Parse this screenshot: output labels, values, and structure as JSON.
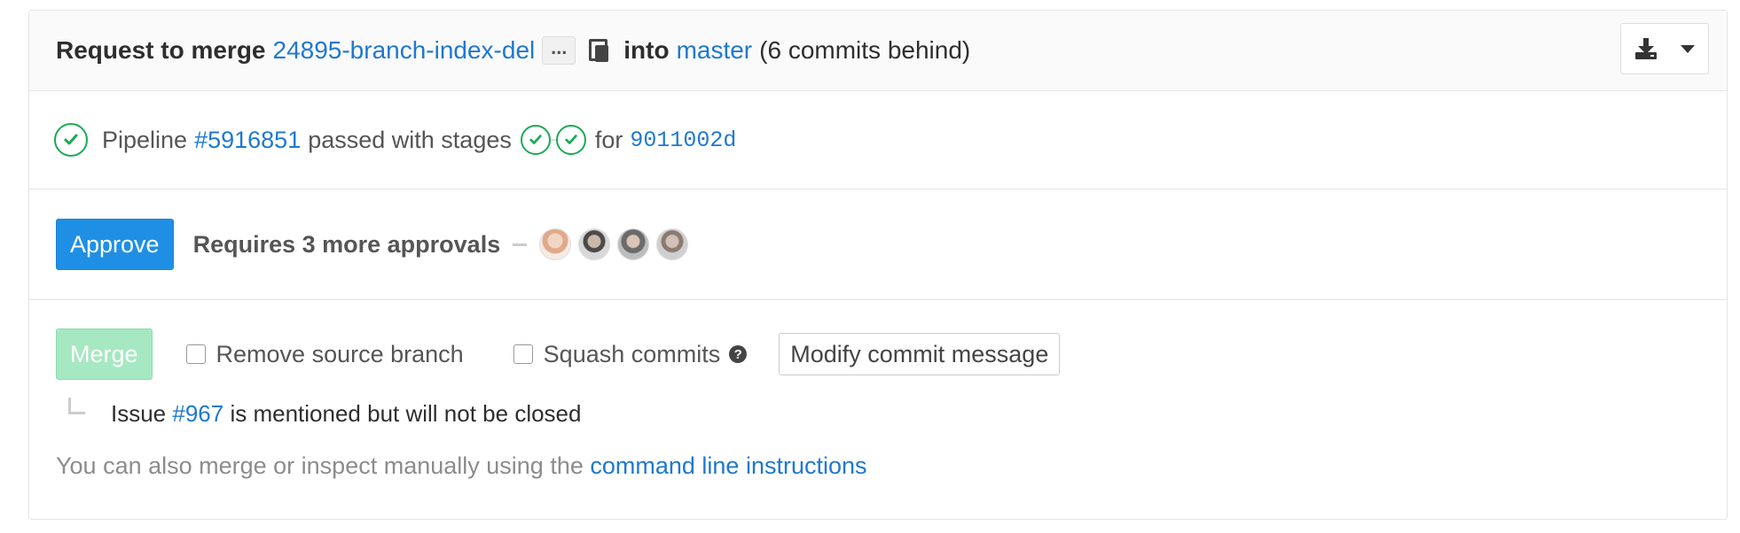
{
  "header": {
    "request_to_merge": "Request to merge",
    "source_branch": "24895-branch-index-del",
    "ellipsis": "...",
    "into": "into",
    "target_branch": "master",
    "commits_behind": "(6 commits behind)"
  },
  "pipeline": {
    "label": "Pipeline",
    "id": "#5916851",
    "status_text": "passed with stages",
    "for": "for",
    "sha": "9011002d",
    "status_color": "#1aaa55"
  },
  "approvals": {
    "approve_label": "Approve",
    "requires_text": "Requires 3 more approvals"
  },
  "merge": {
    "merge_label": "Merge",
    "remove_source_branch": "Remove source branch",
    "squash_commits": "Squash commits",
    "help_glyph": "?",
    "modify_commit_message": "Modify commit message",
    "issue_prefix": "Issue",
    "issue_number": "#967",
    "issue_suffix": "is mentioned but will not be closed",
    "manual_prefix": "You can also merge or inspect manually using the",
    "manual_link": "command line instructions"
  },
  "colors": {
    "link": "#1f78d1",
    "approve_button": "#1f8fe5",
    "merge_button_disabled": "#a6e8c2",
    "success": "#1aaa55"
  },
  "icons": [
    "clipboard-icon",
    "download-icon",
    "caret-down-icon",
    "check-circle-icon",
    "question-circle-icon"
  ]
}
